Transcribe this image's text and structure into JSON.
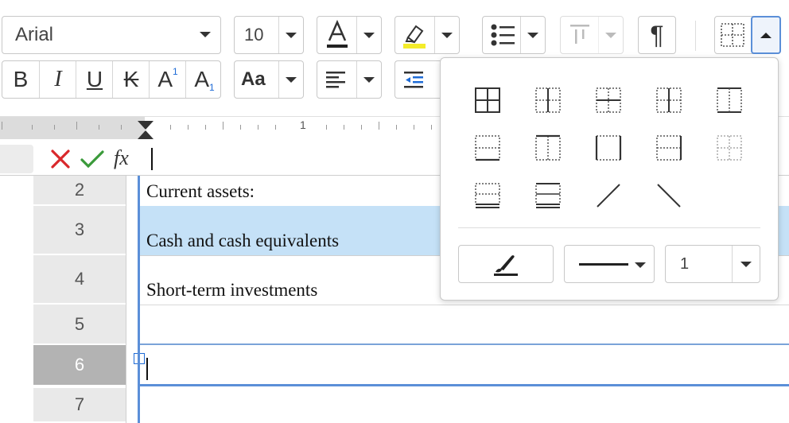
{
  "toolbar": {
    "font_name": "Arial",
    "font_size": "10",
    "paragraph_mark": "¶",
    "case_label": "Aa"
  },
  "format_buttons": [
    {
      "name": "bold-button",
      "label": "B"
    },
    {
      "name": "italic-button",
      "label": "I"
    },
    {
      "name": "underline-button",
      "label": "U"
    },
    {
      "name": "strikethrough-button",
      "label": "K"
    },
    {
      "name": "superscript-button",
      "label": "A",
      "sub": "1"
    },
    {
      "name": "subscript-button",
      "label": "A",
      "sub": "1"
    }
  ],
  "ruler": {
    "mark_1": "1"
  },
  "formula_bar": {
    "fx_label": "fx",
    "value": ""
  },
  "rows": [
    {
      "number": "2",
      "text": "Current assets:"
    },
    {
      "number": "3",
      "text": "Cash and cash equivalents"
    },
    {
      "number": "4",
      "text": "Short-term investments"
    },
    {
      "number": "5",
      "text": ""
    },
    {
      "number": "6",
      "text": ""
    },
    {
      "number": "7",
      "text": ""
    }
  ],
  "borders_popup": {
    "line_width": "1",
    "border_options": [
      "all-borders",
      "inner-vertical-border",
      "inner-horizontal-border",
      "inner-borders-only",
      "no-inner-border",
      "bottom-border",
      "top-bottom-border",
      "left-right-border",
      "right-border",
      "no-borders",
      "top-border-double",
      "top-bottom-double",
      "diagonal-up",
      "diagonal-down"
    ]
  },
  "colors": {
    "selection_row": "#c5e1f7",
    "row_header": "#e9e9e9",
    "row_header_active": "#b3b3b3",
    "accent": "#1e6bd6",
    "cancel": "#d9282b",
    "confirm": "#3a9a3a",
    "highlight": "#f4ec2a"
  }
}
